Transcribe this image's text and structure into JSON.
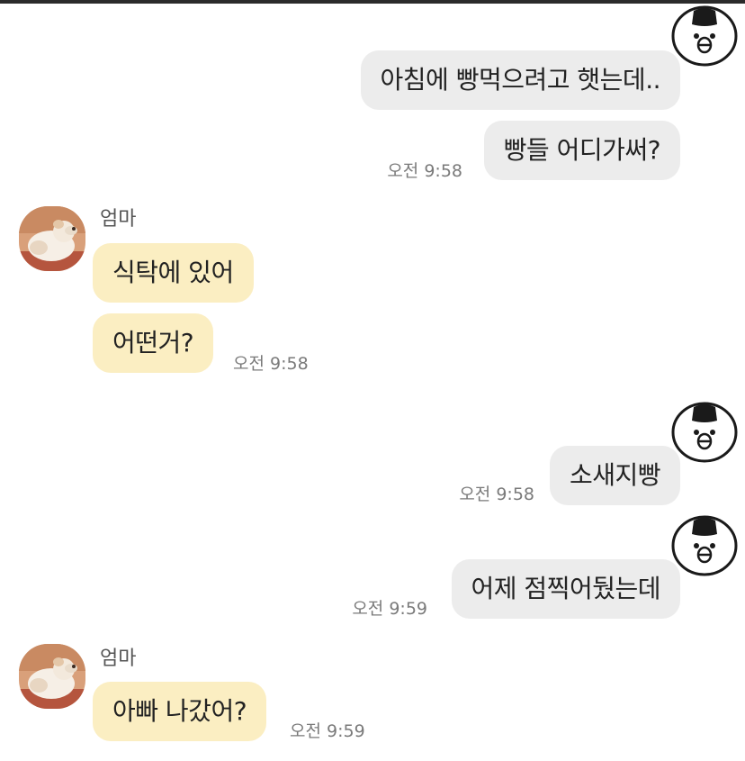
{
  "messages": [
    {
      "text": "아침에 빵먹으려고 햇는데.."
    },
    {
      "text": "빵들 어디가써?",
      "time": "오전 9:58"
    },
    {
      "sender": "엄마",
      "text": "식탁에 있어"
    },
    {
      "text": "어떤거?",
      "time": "오전 9:58"
    },
    {
      "text": "소새지빵",
      "time": "오전 9:58"
    },
    {
      "text": "어제 점찍어뒀는데",
      "time": "오전 9:59"
    },
    {
      "sender": "엄마",
      "text": "아빠 나갔어?",
      "time": "오전 9:59"
    }
  ],
  "colors": {
    "outgoing_bubble": "#ececec",
    "incoming_bubble": "#fbeec2",
    "timestamp": "#7a7a7a"
  },
  "icons": {
    "my_avatar": "rice-ball-face-icon",
    "mom_avatar": "puppy-photo"
  }
}
